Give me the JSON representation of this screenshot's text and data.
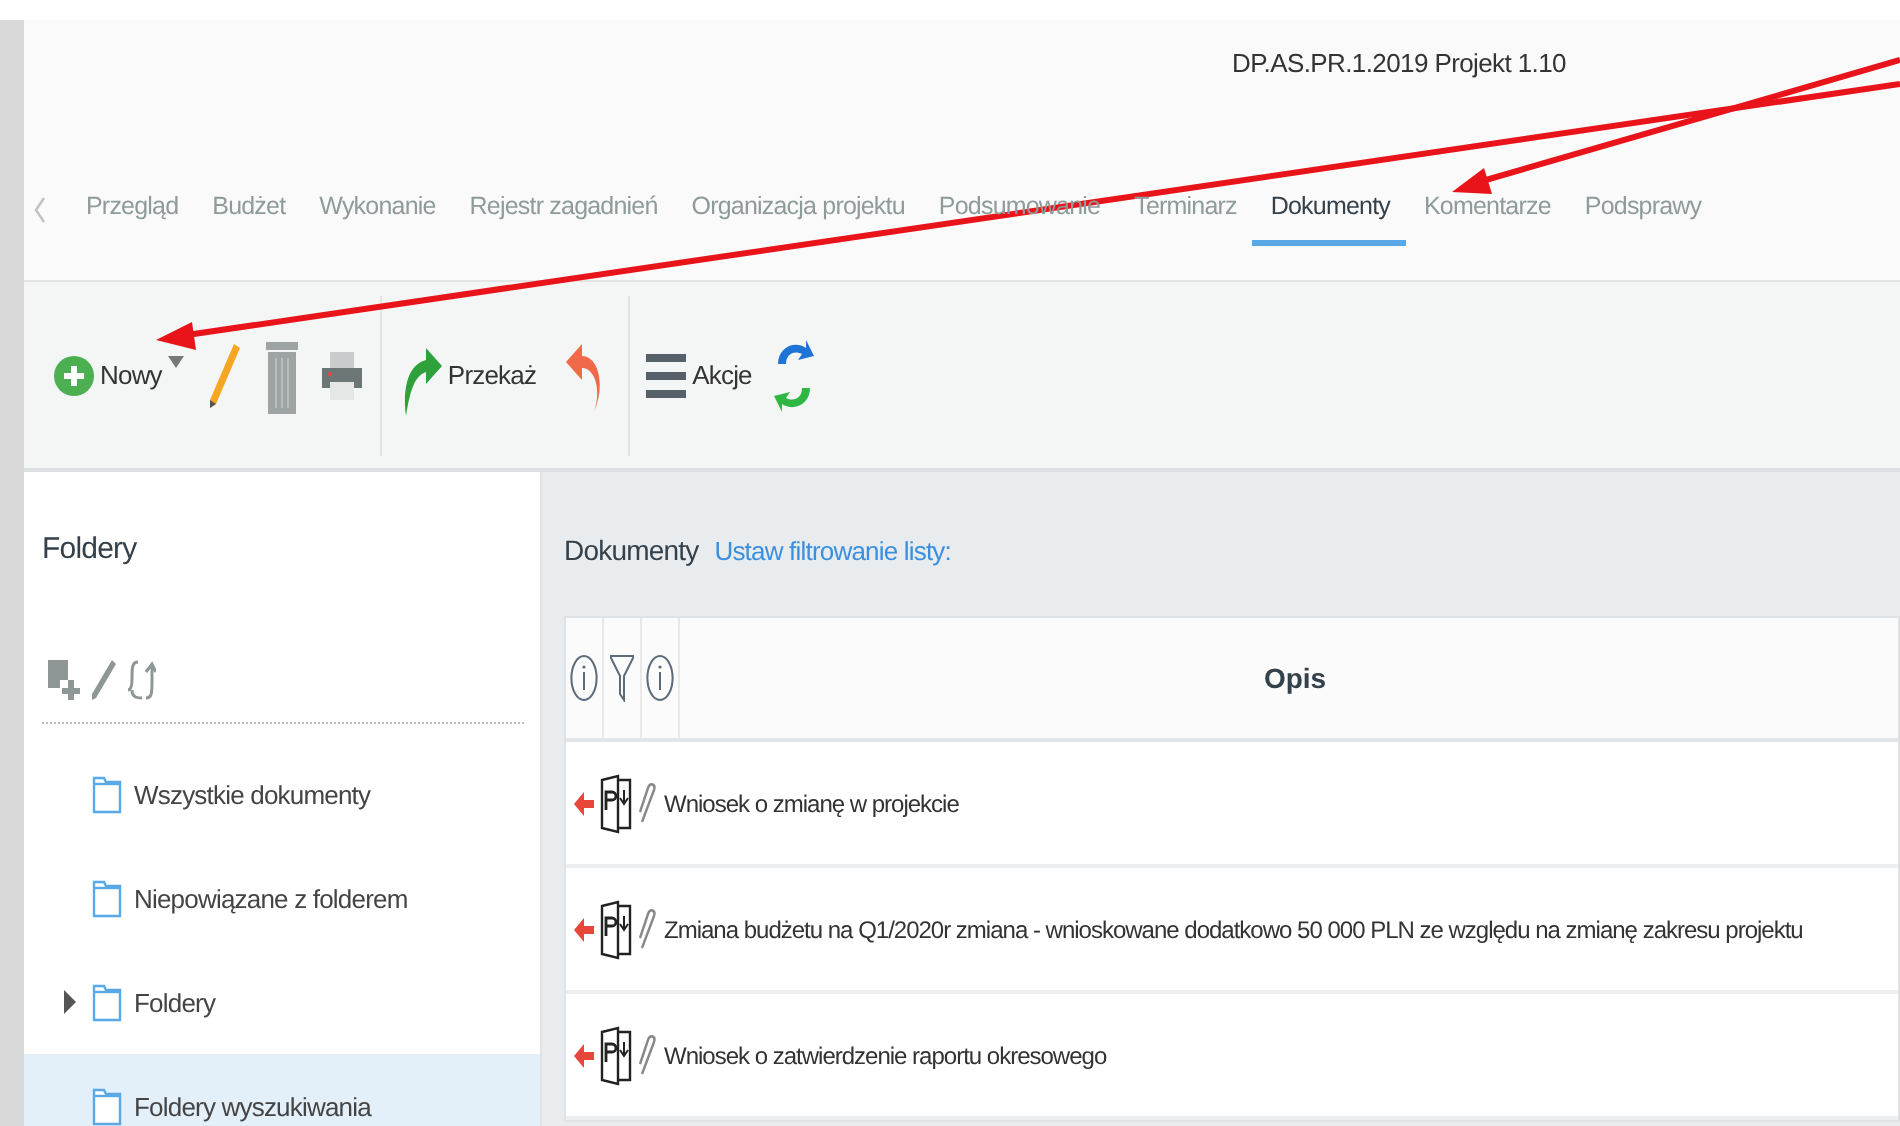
{
  "window": {
    "title": "DP.AS.PR.1.2019 Projekt 1.10"
  },
  "tabs": [
    {
      "label": "Przegląd",
      "selected": false
    },
    {
      "label": "Budżet",
      "selected": false
    },
    {
      "label": "Wykonanie",
      "selected": false
    },
    {
      "label": "Rejestr zagadnień",
      "selected": false
    },
    {
      "label": "Organizacja projektu",
      "selected": false
    },
    {
      "label": "Podsumowanie",
      "selected": false
    },
    {
      "label": "Terminarz",
      "selected": false
    },
    {
      "label": "Dokumenty",
      "selected": true
    },
    {
      "label": "Komentarze",
      "selected": false
    },
    {
      "label": "Podsprawy",
      "selected": false
    }
  ],
  "toolbar": [
    {
      "kind": "new",
      "label": "Nowy"
    },
    {
      "kind": "edit"
    },
    {
      "kind": "delete"
    },
    {
      "kind": "print"
    },
    {
      "kind": "separator"
    },
    {
      "kind": "forward",
      "label": "Przekaż"
    },
    {
      "kind": "undo"
    },
    {
      "kind": "separator"
    },
    {
      "kind": "actions",
      "label": "Akcje"
    },
    {
      "kind": "refresh"
    }
  ],
  "sidebar": {
    "title": "Foldery",
    "items": [
      {
        "label": "Wszystkie dokumenty",
        "kind": "leaf",
        "selected": false
      },
      {
        "label": "Niepowiązane z folderem",
        "kind": "leaf",
        "selected": false
      },
      {
        "label": "Foldery",
        "kind": "branch",
        "expanded": false,
        "selected": false
      },
      {
        "label": "Foldery wyszukiwania",
        "kind": "leaf",
        "selected": true
      }
    ]
  },
  "documents": {
    "title": "Dokumenty",
    "filter_link": "Ustaw filtrowanie listy:",
    "table": {
      "columns": [
        "Opis"
      ],
      "rows": [
        {
          "description": "Wniosek o zmianę w projekcie"
        },
        {
          "description": "Zmiana budżetu na Q1/2020r zmiana - wnioskowane dodatkowo 50 000 PLN ze względu na zmianę zakresu projektu"
        },
        {
          "description": "Wniosek o zatwierdzenie raportu okresowego"
        }
      ]
    }
  }
}
